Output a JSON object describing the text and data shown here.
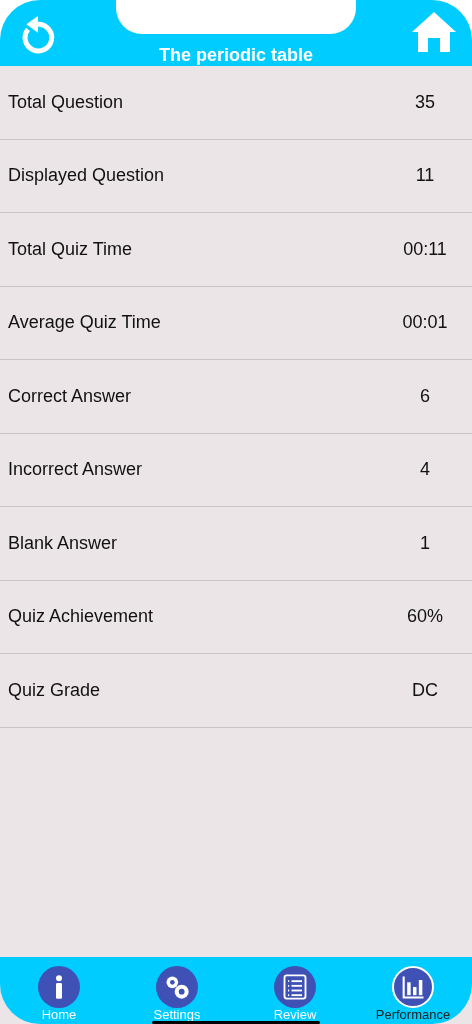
{
  "header": {
    "title": "The periodic table"
  },
  "stats": [
    {
      "label": "Total Question",
      "value": "35"
    },
    {
      "label": "Displayed Question",
      "value": "11"
    },
    {
      "label": "Total Quiz Time",
      "value": "00:11"
    },
    {
      "label": "Average Quiz Time",
      "value": "00:01"
    },
    {
      "label": "Correct Answer",
      "value": "6"
    },
    {
      "label": "Incorrect Answer",
      "value": "4"
    },
    {
      "label": "Blank Answer",
      "value": "1"
    },
    {
      "label": "Quiz Achievement",
      "value": "60%"
    },
    {
      "label": "Quiz Grade",
      "value": "DC"
    }
  ],
  "tab_bar": [
    {
      "kind": "info",
      "label": "Home",
      "selected": false
    },
    {
      "kind": "gears",
      "label": "Settings",
      "selected": false
    },
    {
      "kind": "list",
      "label": "Review",
      "selected": false
    },
    {
      "kind": "chart",
      "label": "Performance",
      "selected": true
    }
  ]
}
